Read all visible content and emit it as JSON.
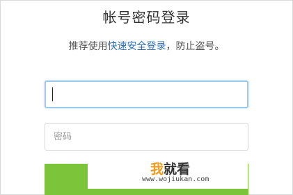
{
  "header": {
    "title": "帐号密码登录",
    "subtitle_prefix": "推荐使用",
    "subtitle_link": "快速安全登录",
    "subtitle_suffix": "，防止盗号。"
  },
  "form": {
    "account_value": "",
    "password_placeholder": "密码"
  },
  "watermark": {
    "char1": "我",
    "char2": "就看",
    "url": "www.wojiukan.com"
  },
  "colors": {
    "link": "#2a6fb8",
    "button": "#7cc43a",
    "focus_border": "#9cc8ec"
  }
}
